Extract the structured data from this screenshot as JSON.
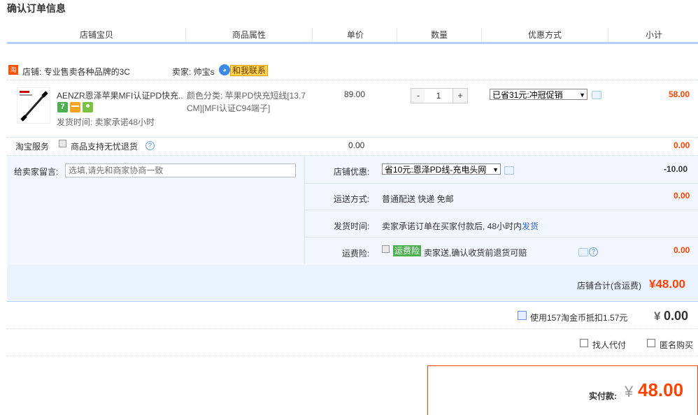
{
  "page_title": "确认订单信息",
  "columns": [
    "店铺宝贝",
    "商品属性",
    "单价",
    "数量",
    "优惠方式",
    "小计"
  ],
  "shop": {
    "icon": "淘",
    "label": "店铺: 专业售卖各种品牌的3C",
    "seller_label": "卖家: 帅宝s",
    "contact_label": "和我联系"
  },
  "item": {
    "name": "AENZR恩泽苹果MFI认证PD快充...",
    "badges": [
      "7",
      "card",
      "vip"
    ],
    "ship_time": "发货时间: 卖家承诺48小时",
    "attr_line1": "颜色分类: 苹果PD快充短线[13.7",
    "attr_line2": "CM][MFI认证C94端子]",
    "price": "89.00",
    "quantity": "1",
    "minus_label": "-",
    "plus_label": "+",
    "discount_selected": "已省31元:冲冠促销",
    "subtotal": "58.00"
  },
  "service": {
    "label": "淘宝服务",
    "option": "商品支持无忧退货",
    "price": "0.00",
    "subtotal": "0.00"
  },
  "message": {
    "label": "给卖家留言:",
    "placeholder": "选填,请先和商家协商一致"
  },
  "shop_discount": {
    "label": "店铺优惠:",
    "selected": "省10元:恩泽PD线-充电头网",
    "value": "-10.00"
  },
  "shipping": {
    "label": "运送方式:",
    "value": "普通配送 快递 免邮",
    "amount": "0.00"
  },
  "delivery": {
    "label": "发货时间:",
    "value": "卖家承诺订单在买家付款后, 48小时内",
    "link": "发货"
  },
  "insurance": {
    "label": "运费险:",
    "tag": "运费险",
    "desc": "卖家送,确认收货前退货可赔",
    "amount": "0.00"
  },
  "shop_total": {
    "label": "店铺合计(含运费)",
    "value": "¥48.00"
  },
  "coins": {
    "label": "使用157淘金币抵扣1.57元",
    "currency": "¥",
    "value": "0.00"
  },
  "options": {
    "proxy_label": "找人代付",
    "anon_label": "匿名购买"
  },
  "payment": {
    "label": "实付款:",
    "currency": "¥",
    "value": "48.00"
  },
  "colors": {
    "accent": "#ff4400",
    "header_line": "#b2d1ff",
    "panel_bg": "#f2f7ff"
  }
}
